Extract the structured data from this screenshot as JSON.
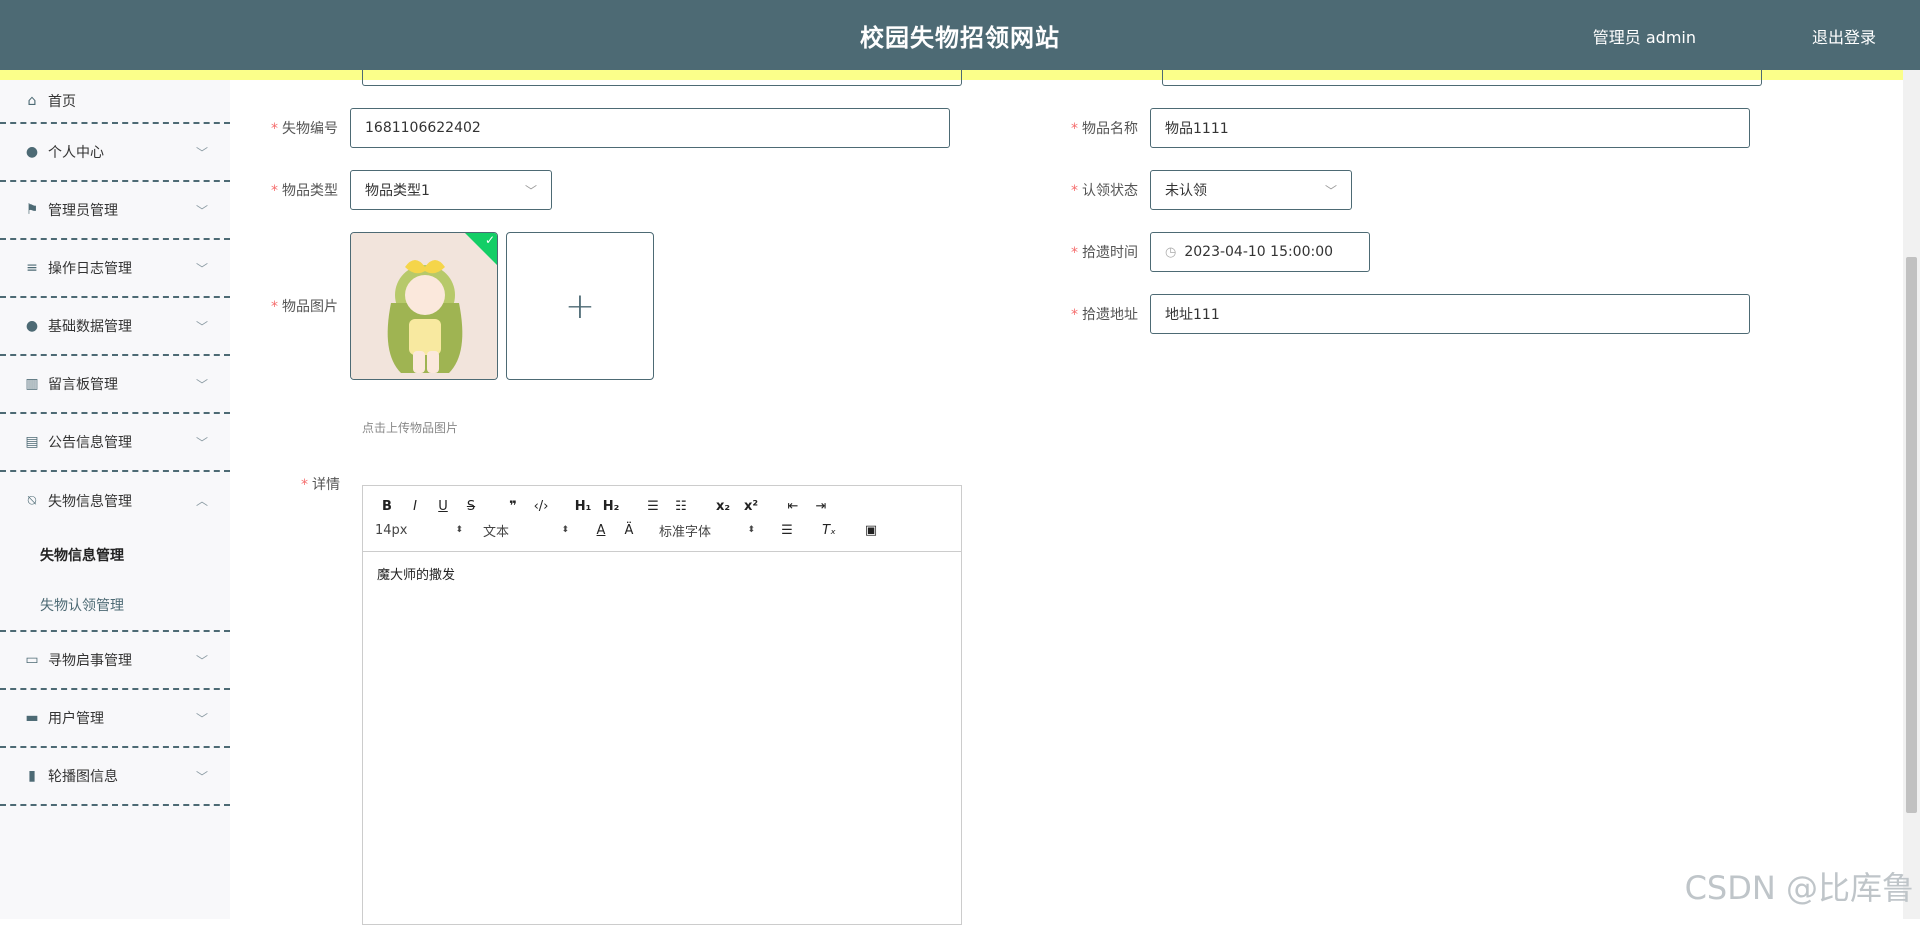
{
  "header": {
    "title": "校园失物招领网站",
    "user": "管理员 admin",
    "logout": "退出登录"
  },
  "sidebar": {
    "items": [
      {
        "label": "首页",
        "icon": "home-icon"
      },
      {
        "label": "个人中心",
        "icon": "user-icon"
      },
      {
        "label": "管理员管理",
        "icon": "flag-icon"
      },
      {
        "label": "操作日志管理",
        "icon": "list-icon"
      },
      {
        "label": "基础数据管理",
        "icon": "user-icon"
      },
      {
        "label": "留言板管理",
        "icon": "bar-chart-icon"
      },
      {
        "label": "公告信息管理",
        "icon": "book-icon"
      },
      {
        "label": "失物信息管理",
        "icon": "bell-off-icon"
      },
      {
        "label": "寻物启事管理",
        "icon": "card-icon"
      },
      {
        "label": "用户管理",
        "icon": "briefcase-icon"
      },
      {
        "label": "轮播图信息",
        "icon": "clipboard-icon"
      }
    ],
    "submenu": [
      {
        "label": "失物信息管理"
      },
      {
        "label": "失物认领管理"
      }
    ]
  },
  "form": {
    "lost_no_label": "失物编号",
    "lost_no_value": "1681106622402",
    "item_name_label": "物品名称",
    "item_name_value": "物品1111",
    "item_type_label": "物品类型",
    "item_type_value": "物品类型1",
    "claim_status_label": "认领状态",
    "claim_status_value": "未认领",
    "pickup_time_label": "拾遗时间",
    "pickup_time_value": "2023-04-10 15:00:00",
    "pickup_addr_label": "拾遗地址",
    "pickup_addr_value": "地址111",
    "image_label": "物品图片",
    "upload_hint": "点击上传物品图片",
    "detail_label": "详情"
  },
  "editor": {
    "font_size": "14px",
    "block": "文本",
    "font_family": "标准字体",
    "content": "魔大师的撒发"
  },
  "watermark": "CSDN @比库鲁"
}
